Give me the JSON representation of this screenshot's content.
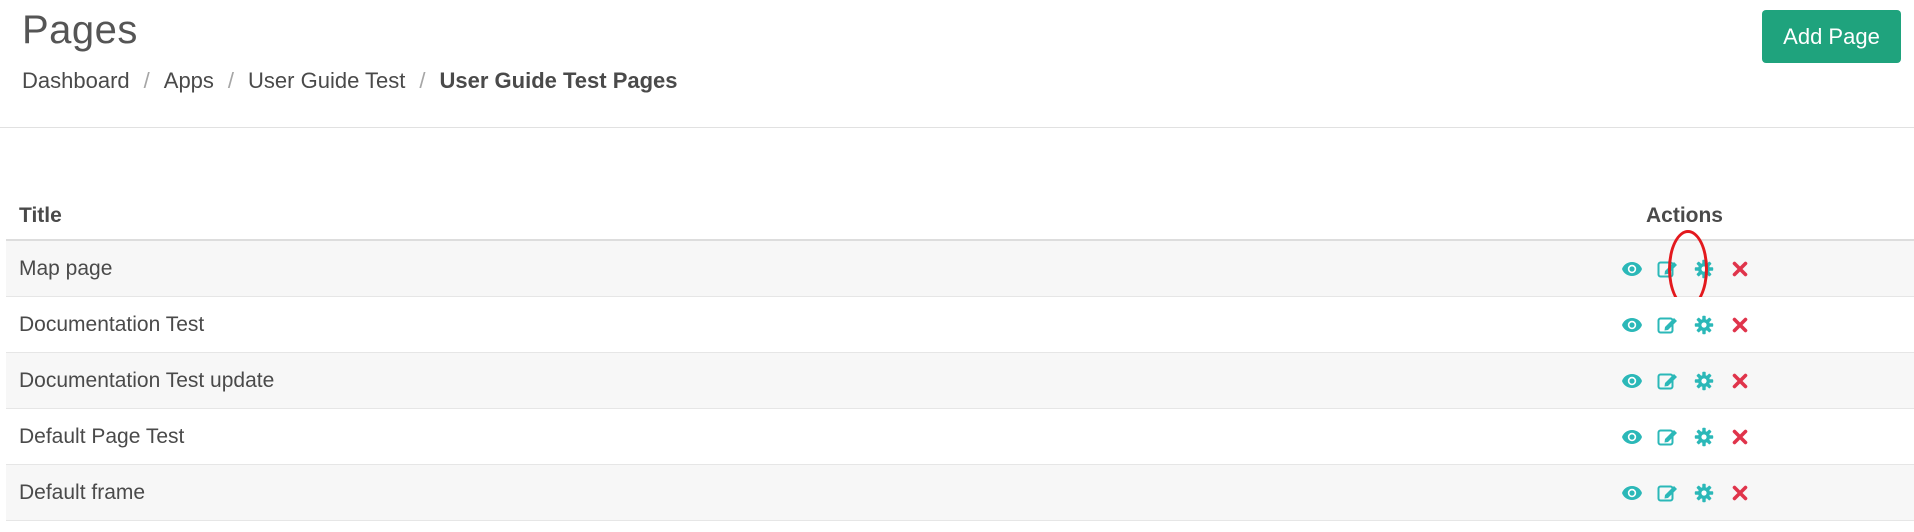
{
  "header": {
    "title": "Pages",
    "add_button_label": "Add Page"
  },
  "breadcrumb": {
    "items": [
      "Dashboard",
      "Apps",
      "User Guide Test",
      "User Guide Test Pages"
    ],
    "separator": "/"
  },
  "table": {
    "columns": [
      "Title",
      "Actions"
    ],
    "rows": [
      {
        "title": "Map page",
        "highlighted_action": "settings"
      },
      {
        "title": "Documentation Test"
      },
      {
        "title": "Documentation Test update"
      },
      {
        "title": "Default Page Test"
      },
      {
        "title": "Default frame"
      }
    ],
    "row_actions": [
      "view-icon",
      "edit-icon",
      "settings-icon",
      "delete-icon"
    ]
  },
  "colors": {
    "accent": "#1fa37d",
    "icon_teal": "#2bb8b8",
    "delete_red": "#e0344b",
    "highlight_red": "#e3191e"
  }
}
